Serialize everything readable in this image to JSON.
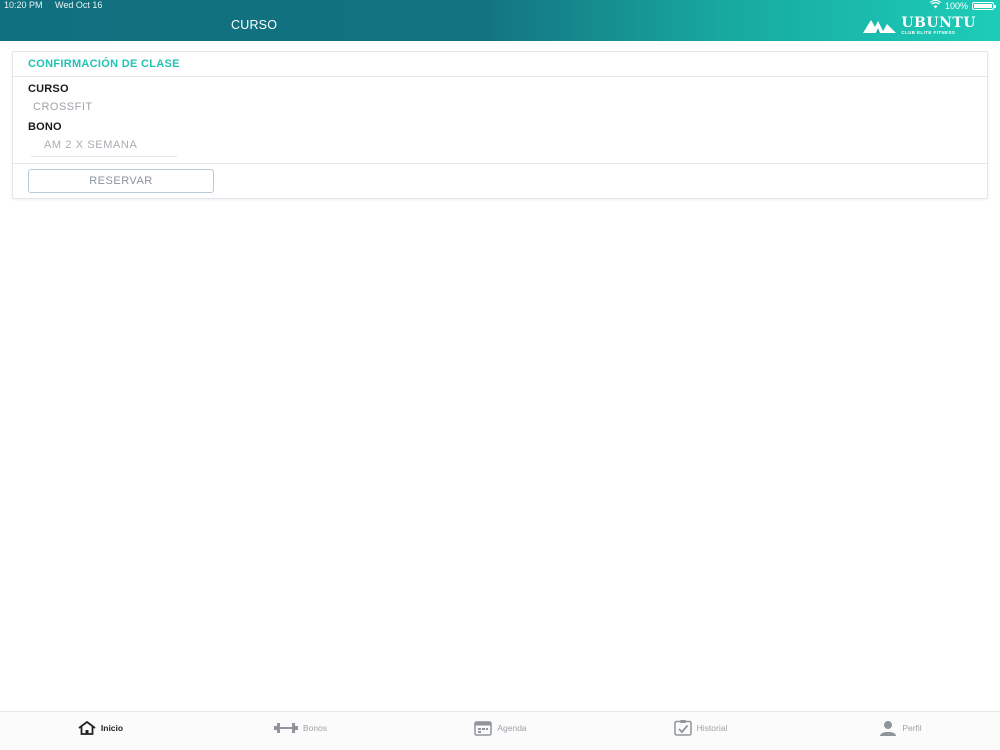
{
  "status_bar": {
    "time": "10:20 PM",
    "date": "Wed Oct 16",
    "battery": "100%",
    "battery_level": 1.0
  },
  "nav": {
    "title": "CURSO",
    "brand_name": "UBUNTU",
    "brand_tagline": "CLUB ELITE FITNESS"
  },
  "card": {
    "header": "CONFIRMACIÓN DE CLASE",
    "curso_label": "CURSO",
    "curso_value": "CROSSFIT",
    "bono_label": "BONO",
    "bono_selected": "AM 2 X SEMANA",
    "reserve_button": "RESERVAR"
  },
  "tabs": [
    {
      "label": "Inicio",
      "icon": "home-icon",
      "active": true
    },
    {
      "label": "Bonos",
      "icon": "dumbbell-icon",
      "active": false
    },
    {
      "label": "Agenda",
      "icon": "calendar-icon",
      "active": false
    },
    {
      "label": "Historial",
      "icon": "checklist-icon",
      "active": false
    },
    {
      "label": "Perfil",
      "icon": "person-icon",
      "active": false
    }
  ],
  "colors": {
    "header_gradient_start": "#11707f",
    "header_gradient_end": "#1dcdb8",
    "accent": "#20c2b3",
    "text_dark": "#1b1b1b",
    "text_muted": "#9ea3a8"
  }
}
